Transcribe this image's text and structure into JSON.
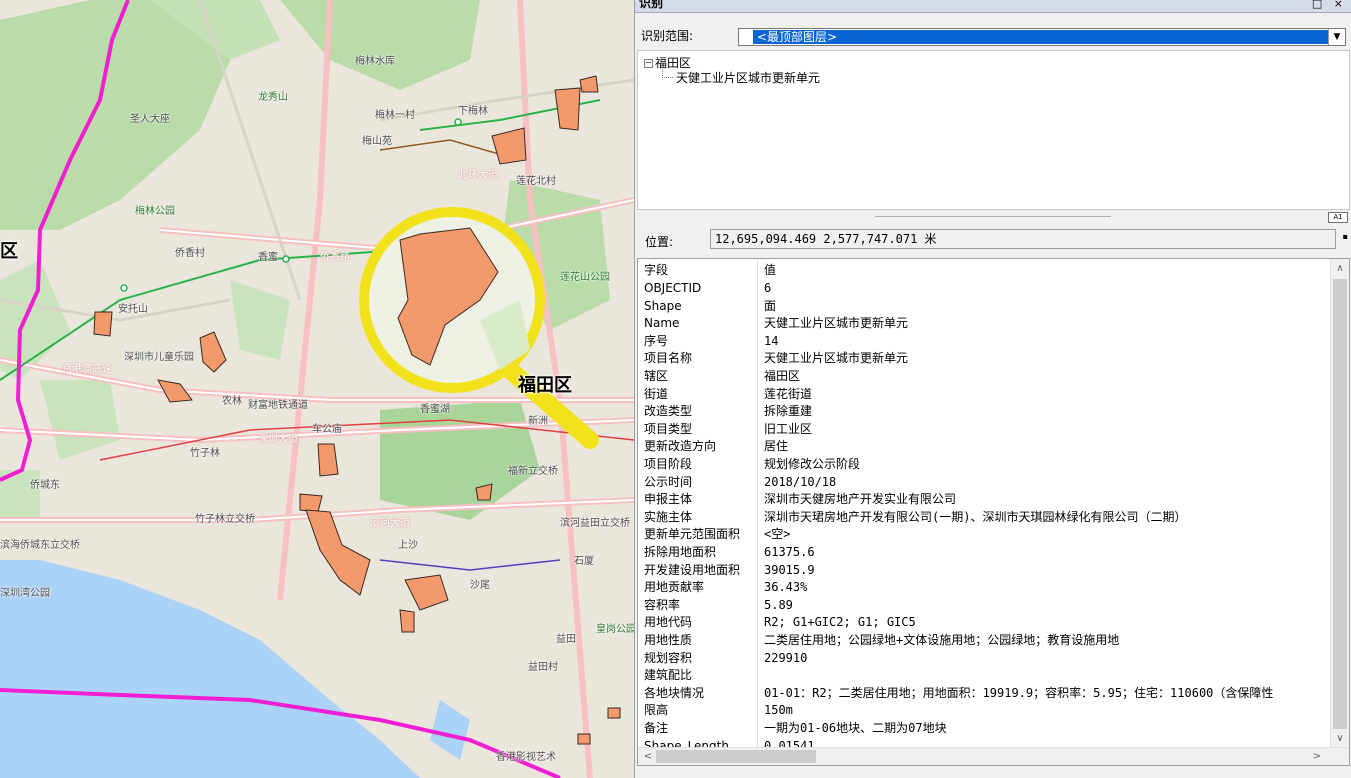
{
  "window": {
    "title": "识别",
    "controls": "□ ×"
  },
  "scope": {
    "label": "识别范围:",
    "selected": "<最顶部图层>"
  },
  "tree": {
    "root": "福田区",
    "child": "天健工业片区城市更新单元",
    "expander": "⊟"
  },
  "position": {
    "label": "位置:",
    "value": "12,695,094.469  2,577,747.071 米"
  },
  "table": {
    "headers": {
      "field": "字段",
      "value": "值"
    },
    "rows": [
      {
        "field": "OBJECTID",
        "value": "6"
      },
      {
        "field": "Shape",
        "value": "面"
      },
      {
        "field": "Name",
        "value": "天健工业片区城市更新单元"
      },
      {
        "field": "序号",
        "value": "14"
      },
      {
        "field": "项目名称",
        "value": "天健工业片区城市更新单元"
      },
      {
        "field": "辖区",
        "value": "福田区"
      },
      {
        "field": "街道",
        "value": "莲花街道"
      },
      {
        "field": "改造类型",
        "value": "拆除重建"
      },
      {
        "field": "项目类型",
        "value": "旧工业区"
      },
      {
        "field": "更新改造方向",
        "value": "居住"
      },
      {
        "field": "项目阶段",
        "value": "规划修改公示阶段"
      },
      {
        "field": "公示时间",
        "value": "2018/10/18"
      },
      {
        "field": "申报主体",
        "value": "深圳市天健房地产开发实业有限公司"
      },
      {
        "field": "实施主体",
        "value": "深圳市天珺房地产开发有限公司(一期)、深圳市天琪园林绿化有限公司（二期）"
      },
      {
        "field": "更新单元范围面积",
        "value": "<空>"
      },
      {
        "field": "拆除用地面积",
        "value": "61375.6"
      },
      {
        "field": "开发建设用地面积",
        "value": "39015.9"
      },
      {
        "field": "用地贡献率",
        "value": "36.43%"
      },
      {
        "field": "容积率",
        "value": "5.89"
      },
      {
        "field": "用地代码",
        "value": "R2; G1+GIC2; G1; GIC5"
      },
      {
        "field": "用地性质",
        "value": "二类居住用地；公园绿地+文体设施用地；公园绿地；教育设施用地"
      },
      {
        "field": "规划容积",
        "value": "229910"
      },
      {
        "field": "建筑配比",
        "value": ""
      },
      {
        "field": "各地块情况",
        "value": "01-01：R2；二类居住用地；用地面积：19919.9；容积率：5.95；住宅：110600（含保障性"
      },
      {
        "field": "限高",
        "value": "150m"
      },
      {
        "field": "备注",
        "value": "一期为01-06地块、二期为07地块"
      },
      {
        "field": "Shape_Length",
        "value": "0.01541"
      }
    ]
  },
  "map": {
    "labels": [
      {
        "text": "梅林水库"
      },
      {
        "text": "龙秀山"
      },
      {
        "text": "圣人大座"
      },
      {
        "text": "梅林一村"
      },
      {
        "text": "下梅林"
      },
      {
        "text": "梅山苑"
      },
      {
        "text": "梅林公园"
      },
      {
        "text": "北环大道"
      },
      {
        "text": "莲花北村"
      },
      {
        "text": "侨香村"
      },
      {
        "text": "香蜜"
      },
      {
        "text": "侨香路"
      },
      {
        "text": "安托山"
      },
      {
        "text": "深圳市儿童乐园"
      },
      {
        "text": "京港澳高速"
      },
      {
        "text": "农林"
      },
      {
        "text": "财富地铁通道"
      },
      {
        "text": "车公庙"
      },
      {
        "text": "竹子林"
      },
      {
        "text": "深圳大道"
      },
      {
        "text": "竹子林立交桥"
      },
      {
        "text": "滨河大道"
      },
      {
        "text": "上沙"
      },
      {
        "text": "沙尾"
      },
      {
        "text": "益田"
      },
      {
        "text": "益田村"
      },
      {
        "text": "香蜜湖"
      },
      {
        "text": "莲花山公园"
      },
      {
        "text": "福田区"
      },
      {
        "text": "福新立交桥"
      },
      {
        "text": "滨河益田立交桥"
      },
      {
        "text": "石厦"
      },
      {
        "text": "皇岗公园"
      },
      {
        "text": "滨海侨城东立交桥"
      },
      {
        "text": "侨城东"
      },
      {
        "text": "深圳湾公园"
      },
      {
        "text": "香港影视艺术"
      },
      {
        "text": "新洲"
      },
      {
        "text": "区"
      }
    ],
    "colors": {
      "boundary": "#f01fd3",
      "parcel": "#f29a6b",
      "magnifier": "#f2e21b",
      "water": "#aad3f7",
      "green": "#b7dcaa"
    }
  }
}
